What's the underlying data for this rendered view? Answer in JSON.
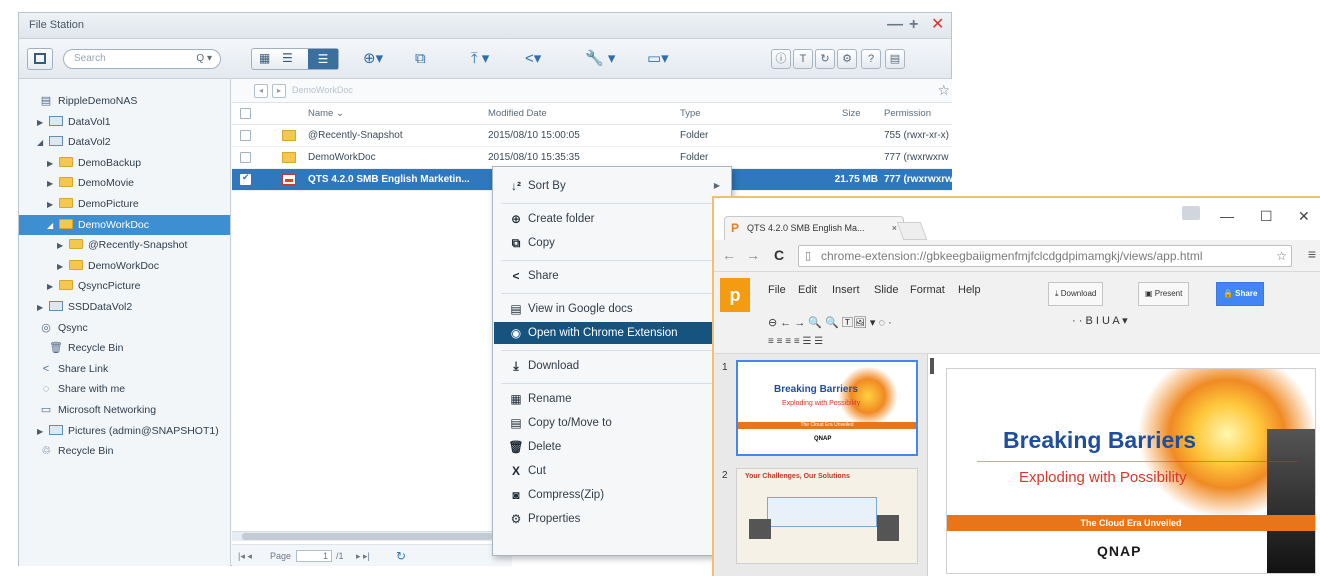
{
  "file_station": {
    "title": "File Station",
    "win_controls": [
      "—",
      "+",
      "✕"
    ],
    "search_placeholder": "Search",
    "toolbar_icons": [
      "view-grid-icon",
      "view-list-icon",
      "view-detail-icon",
      "create-icon",
      "copy-icon",
      "upload-icon",
      "share-icon",
      "tools-icon",
      "remote-mount-icon"
    ],
    "right_toolbar": [
      "ⓘ",
      "T",
      "↻",
      "⚙",
      "?",
      "▤"
    ],
    "breadcrumb": "DemoWorkDoc",
    "sidebar": [
      {
        "label": "RippleDemoNAS",
        "type": "nas",
        "level": 0
      },
      {
        "label": "DataVol1",
        "type": "vol",
        "level": 1,
        "arrow": "▶"
      },
      {
        "label": "DataVol2",
        "type": "vol",
        "level": 1,
        "arrow": "◢"
      },
      {
        "label": "DemoBackup",
        "type": "folder",
        "level": 2,
        "arrow": "▶"
      },
      {
        "label": "DemoMovie",
        "type": "folder",
        "level": 2,
        "arrow": "▶"
      },
      {
        "label": "DemoPicture",
        "type": "folder",
        "level": 2,
        "arrow": "▶"
      },
      {
        "label": "DemoWorkDoc",
        "type": "folder",
        "level": 2,
        "arrow": "◢",
        "selected": true
      },
      {
        "label": "@Recently-Snapshot",
        "type": "folder",
        "level": 3,
        "arrow": "▶"
      },
      {
        "label": "DemoWorkDoc",
        "type": "folder",
        "level": 3,
        "arrow": "▶"
      },
      {
        "label": "QsyncPicture",
        "type": "folder",
        "level": 2,
        "arrow": "▶"
      },
      {
        "label": "SSDDataVol2",
        "type": "vol",
        "level": 1,
        "arrow": "▶"
      },
      {
        "label": "Qsync",
        "type": "qsync",
        "level": 0
      },
      {
        "label": "Recycle Bin",
        "type": "recycle",
        "level": 1
      },
      {
        "label": "Share Link",
        "type": "share",
        "level": 0
      },
      {
        "label": "Share with me",
        "type": "sharewith",
        "level": 0
      },
      {
        "label": "Microsoft Networking",
        "type": "network",
        "level": 0
      },
      {
        "label": "Pictures (admin@SNAPSHOT1)",
        "type": "vol",
        "level": 1,
        "arrow": "▶"
      },
      {
        "label": "Recycle Bin",
        "type": "recycle2",
        "level": 0
      }
    ],
    "columns": {
      "name": "Name ⌄",
      "modified": "Modified Date",
      "type": "Type",
      "size": "Size",
      "permission": "Permission"
    },
    "rows": [
      {
        "name": "@Recently-Snapshot",
        "modified": "2015/08/10 15:00:05",
        "type": "Folder",
        "size": "",
        "permission": "755 (rwxr-xr-x)",
        "icon": "folder"
      },
      {
        "name": "DemoWorkDoc",
        "modified": "2015/08/10 15:35:35",
        "type": "Folder",
        "size": "",
        "permission": "777 (rwxrwxrw",
        "icon": "folder"
      },
      {
        "name": "QTS 4.2.0 SMB English Marketin...",
        "modified": "",
        "type": "",
        "size": "21.75 MB",
        "permission": "777 (rwxrwxrw",
        "icon": "pdf",
        "selected": true
      }
    ],
    "pager": {
      "page_label": "Page",
      "page_value": "1",
      "of": "/1"
    }
  },
  "context_menu": [
    {
      "label": "Sort By",
      "icon": "↓²",
      "submenu": true
    },
    {
      "sep": true
    },
    {
      "label": "Create folder",
      "icon": "⊕"
    },
    {
      "label": "Copy",
      "icon": "⧉"
    },
    {
      "sep": true
    },
    {
      "label": "Share",
      "icon": "<"
    },
    {
      "sep": true
    },
    {
      "label": "View in Google docs",
      "icon": "▤"
    },
    {
      "label": "Open with Chrome Extension",
      "icon": "◉",
      "highlight": true
    },
    {
      "sep": true
    },
    {
      "label": "Download",
      "icon": "⤓"
    },
    {
      "sep": true
    },
    {
      "label": "Rename",
      "icon": "▦"
    },
    {
      "label": "Copy to/Move to",
      "icon": "▤"
    },
    {
      "label": "Delete",
      "icon": "🗑"
    },
    {
      "label": "Cut",
      "icon": "X"
    },
    {
      "label": "Compress(Zip)",
      "icon": "◙"
    },
    {
      "label": "Properties",
      "icon": "⚙"
    }
  ],
  "chrome": {
    "tab_title": "QTS 4.2.0 SMB English Ma...",
    "tab_close": "×",
    "win_controls": [
      "—",
      "☐",
      "✕"
    ],
    "url": "chrome-extension://gbkeegbaiigmenfmjfclcdgdpimamgkj/views/app.html",
    "slides_app": {
      "logo": "p",
      "menu": [
        "File",
        "Edit",
        "Insert",
        "Slide",
        "Format",
        "Help"
      ],
      "buttons": {
        "download": "⤓ Download",
        "present": "▣ Present",
        "share": "🔒 Share"
      },
      "tools_row": "⊖  ←  →   🔍  🔍   🅃🖼 ▾  ◌ ·",
      "tools_row2": "≡  ≡  ≡  ≡    ☰  ☰",
      "format_row": "·              ·     B   I   U     A ▾"
    },
    "thumbnails": [
      {
        "num": "1",
        "title": "Breaking Barriers",
        "sub": "Exploding with Possibility",
        "band": "The Cloud Era Unveiled",
        "logo": "QNAP"
      },
      {
        "num": "2",
        "title": "Your Challenges, Our Solutions"
      }
    ],
    "slide": {
      "title": "Breaking Barriers",
      "subtitle": "Exploding with Possibility",
      "band": "The Cloud Era Unveiled",
      "logo": "QNAP"
    }
  }
}
